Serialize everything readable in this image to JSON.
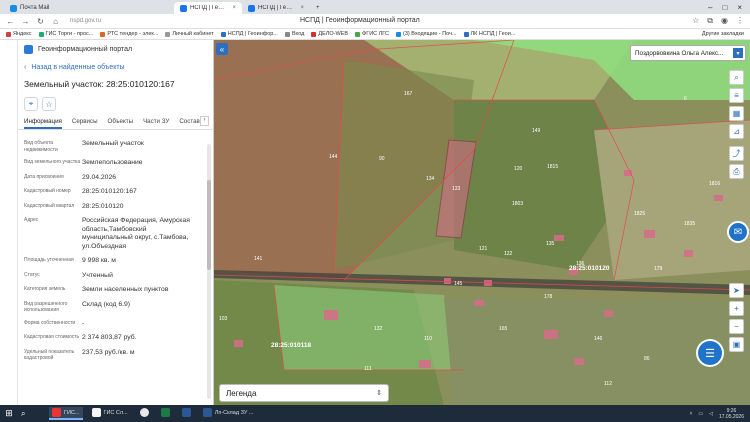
{
  "browser": {
    "tabs": [
      {
        "label": "Почта Mail",
        "active": false
      },
      {
        "label": "НСПД | Геоинформацио...",
        "active": true
      },
      {
        "label": "НСПД | Геоинформацио...",
        "active": false
      }
    ],
    "url": "nspd.gov.ru",
    "page_title": "НСПД | Геоинформационный портал",
    "bookmarks": [
      "Яндекс",
      "ГИС Торги - прос...",
      "РТС тендер - элек...",
      "Личный кабинет",
      "НСПД | Геоинфор...",
      "Вход",
      "ДЕЛО-WEB",
      "ФГИС ЛГС",
      "(3) Входящие - Поч...",
      "ЛК НСПД | Геои..."
    ],
    "bookmarks_other": "Другие закладки"
  },
  "panel": {
    "portal_name": "Геоинформационный портал",
    "back_link": "Назад в найденные объекты",
    "title": "Земельный участок: 28:25:010120:167",
    "tabs": [
      "Информация",
      "Сервисы",
      "Объекты",
      "Части ЗУ",
      "Состав"
    ],
    "active_tab": "Информация",
    "fields": [
      {
        "label": "Вид объекта недвижимости",
        "value": "Земельный участок"
      },
      {
        "label": "Вид земельного участка",
        "value": "Землепользование"
      },
      {
        "label": "Дата присвоения",
        "value": "29.04.2026"
      },
      {
        "label": "Кадастровый номер",
        "value": "28:25:010120:167"
      },
      {
        "label": "Кадастровый квартал",
        "value": "28:25:010120"
      },
      {
        "label": "Адрес",
        "value": "Российская Федерация, Амурская область,Тамбовский муниципальный округ, с.Тамбова, ул.Объездная"
      },
      {
        "label": "Площадь уточненная",
        "value": "9 998 кв. м"
      },
      {
        "label": "Статус",
        "value": "Учтенный"
      },
      {
        "label": "Категория земель",
        "value": "Земли населенных пунктов"
      },
      {
        "label": "Вид разрешенного использования",
        "value": "Склад (код 6.9)"
      },
      {
        "label": "Форма собственности",
        "value": "-"
      },
      {
        "label": "Кадастровая стоимость",
        "value": "2 374 803,87 руб."
      },
      {
        "label": "Удельный показатель кадастровой",
        "value": "237,53 руб./кв. м"
      }
    ]
  },
  "map": {
    "user": "Поздорвовкина Ольга Алекс...",
    "legend": "Легенда",
    "quarter_labels": [
      "28:25:010120",
      "28:25:010118"
    ],
    "parcel_labels": [
      "167",
      "144",
      "149",
      "133",
      "134",
      "120",
      "145",
      "121",
      "122",
      "135",
      "136",
      "178",
      "179",
      "1803",
      "1815",
      "1825",
      "1835",
      "1816",
      "103",
      "141",
      "90",
      "165",
      "146",
      "132",
      "110",
      "111",
      "112",
      "86",
      "2",
      "6"
    ]
  },
  "taskbar": {
    "items": [
      "ГИС...",
      "ГИС Сл...",
      "",
      "",
      "",
      "Лп-Склад ЗУ ..."
    ],
    "time": "9:26",
    "date": "17.05.2026"
  },
  "colors": {
    "accent": "#2d6fbf",
    "parcel_fill": "#d96b8a",
    "green_zone": "#7ed67a"
  }
}
